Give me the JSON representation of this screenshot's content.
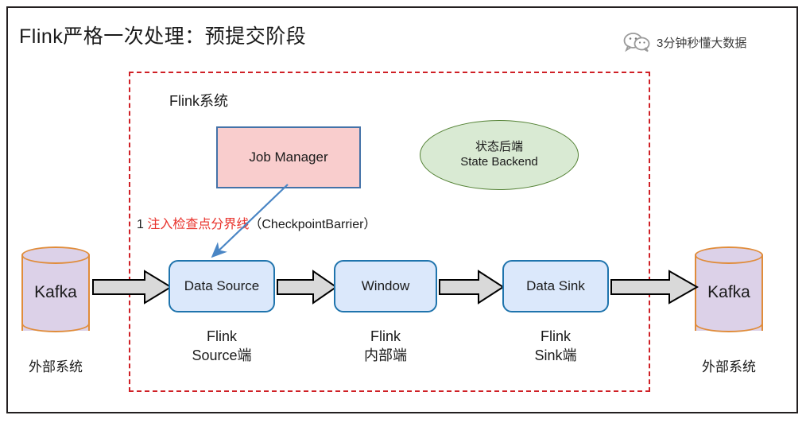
{
  "page": {
    "title": "Flink严格一次处理：预提交阶段",
    "watermark": {
      "icon": "wechat-icon",
      "text": "3分钟秒懂大数据"
    }
  },
  "system_boundary": {
    "label": "Flink系统",
    "border_color": "#cf2026",
    "style": "dashed"
  },
  "job_manager": {
    "label": "Job Manager",
    "fill": "#f9cdcd",
    "border": "#4472a8"
  },
  "state_backend": {
    "line1": "状态后端",
    "line2": "State Backend",
    "fill": "#d9ead3",
    "border": "#548235"
  },
  "annotation": {
    "step": "1",
    "highlight": "注入检查点分界线",
    "suffix": "（CheckpointBarrier）",
    "highlight_color": "#e8302a"
  },
  "external": {
    "left": {
      "name": "Kafka",
      "caption": "外部系统"
    },
    "right": {
      "name": "Kafka",
      "caption": "外部系统"
    },
    "fill": "#dcd1e8",
    "border": "#e08c3a"
  },
  "pipeline": {
    "fill": "#dbe8fb",
    "border": "#1f74ad",
    "stages": [
      {
        "box": "Data Source",
        "label_line1": "Flink",
        "label_line2": "Source端"
      },
      {
        "box": "Window",
        "label_line1": "Flink",
        "label_line2": "内部端"
      },
      {
        "box": "Data Sink",
        "label_line1": "Flink",
        "label_line2": "Sink端"
      }
    ]
  },
  "arrows": {
    "flow_fill": "#d9d9d9",
    "flow_stroke": "#000000",
    "barrier_arrow_color": "#4a86c5",
    "count": 4
  }
}
